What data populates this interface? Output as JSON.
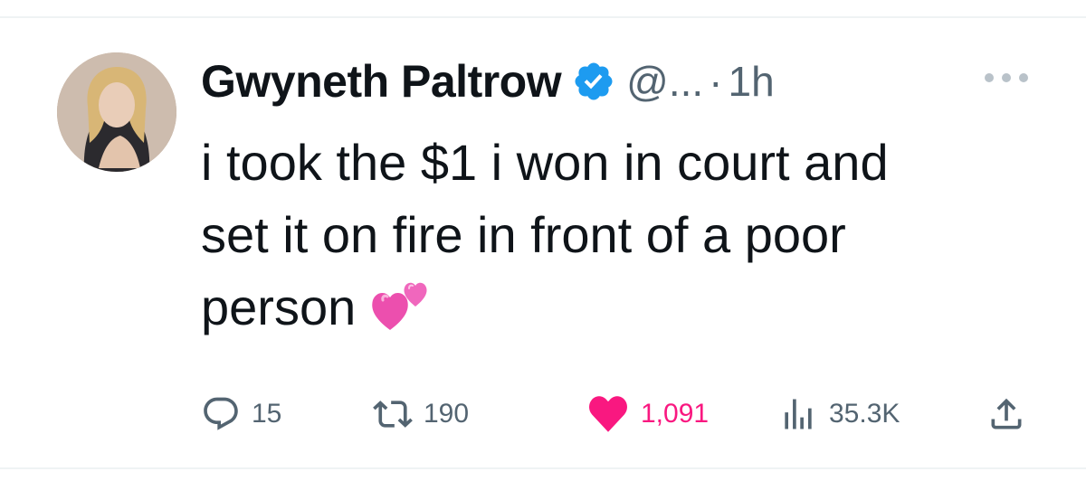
{
  "tweet": {
    "author_name": "Gwyneth Paltrow",
    "handle": "@...",
    "separator": "·",
    "time": "1h",
    "text_lines": [
      "i took the $1 i won in court and",
      "set it on fire in front of a poor",
      "person"
    ],
    "emoji": "two-hearts"
  },
  "actions": {
    "replies": "15",
    "retweets": "190",
    "likes": "1,091",
    "views": "35.3K"
  },
  "colors": {
    "verified_blue": "#1d9bf0",
    "like_pink": "#f91880",
    "secondary_text": "#536471"
  }
}
